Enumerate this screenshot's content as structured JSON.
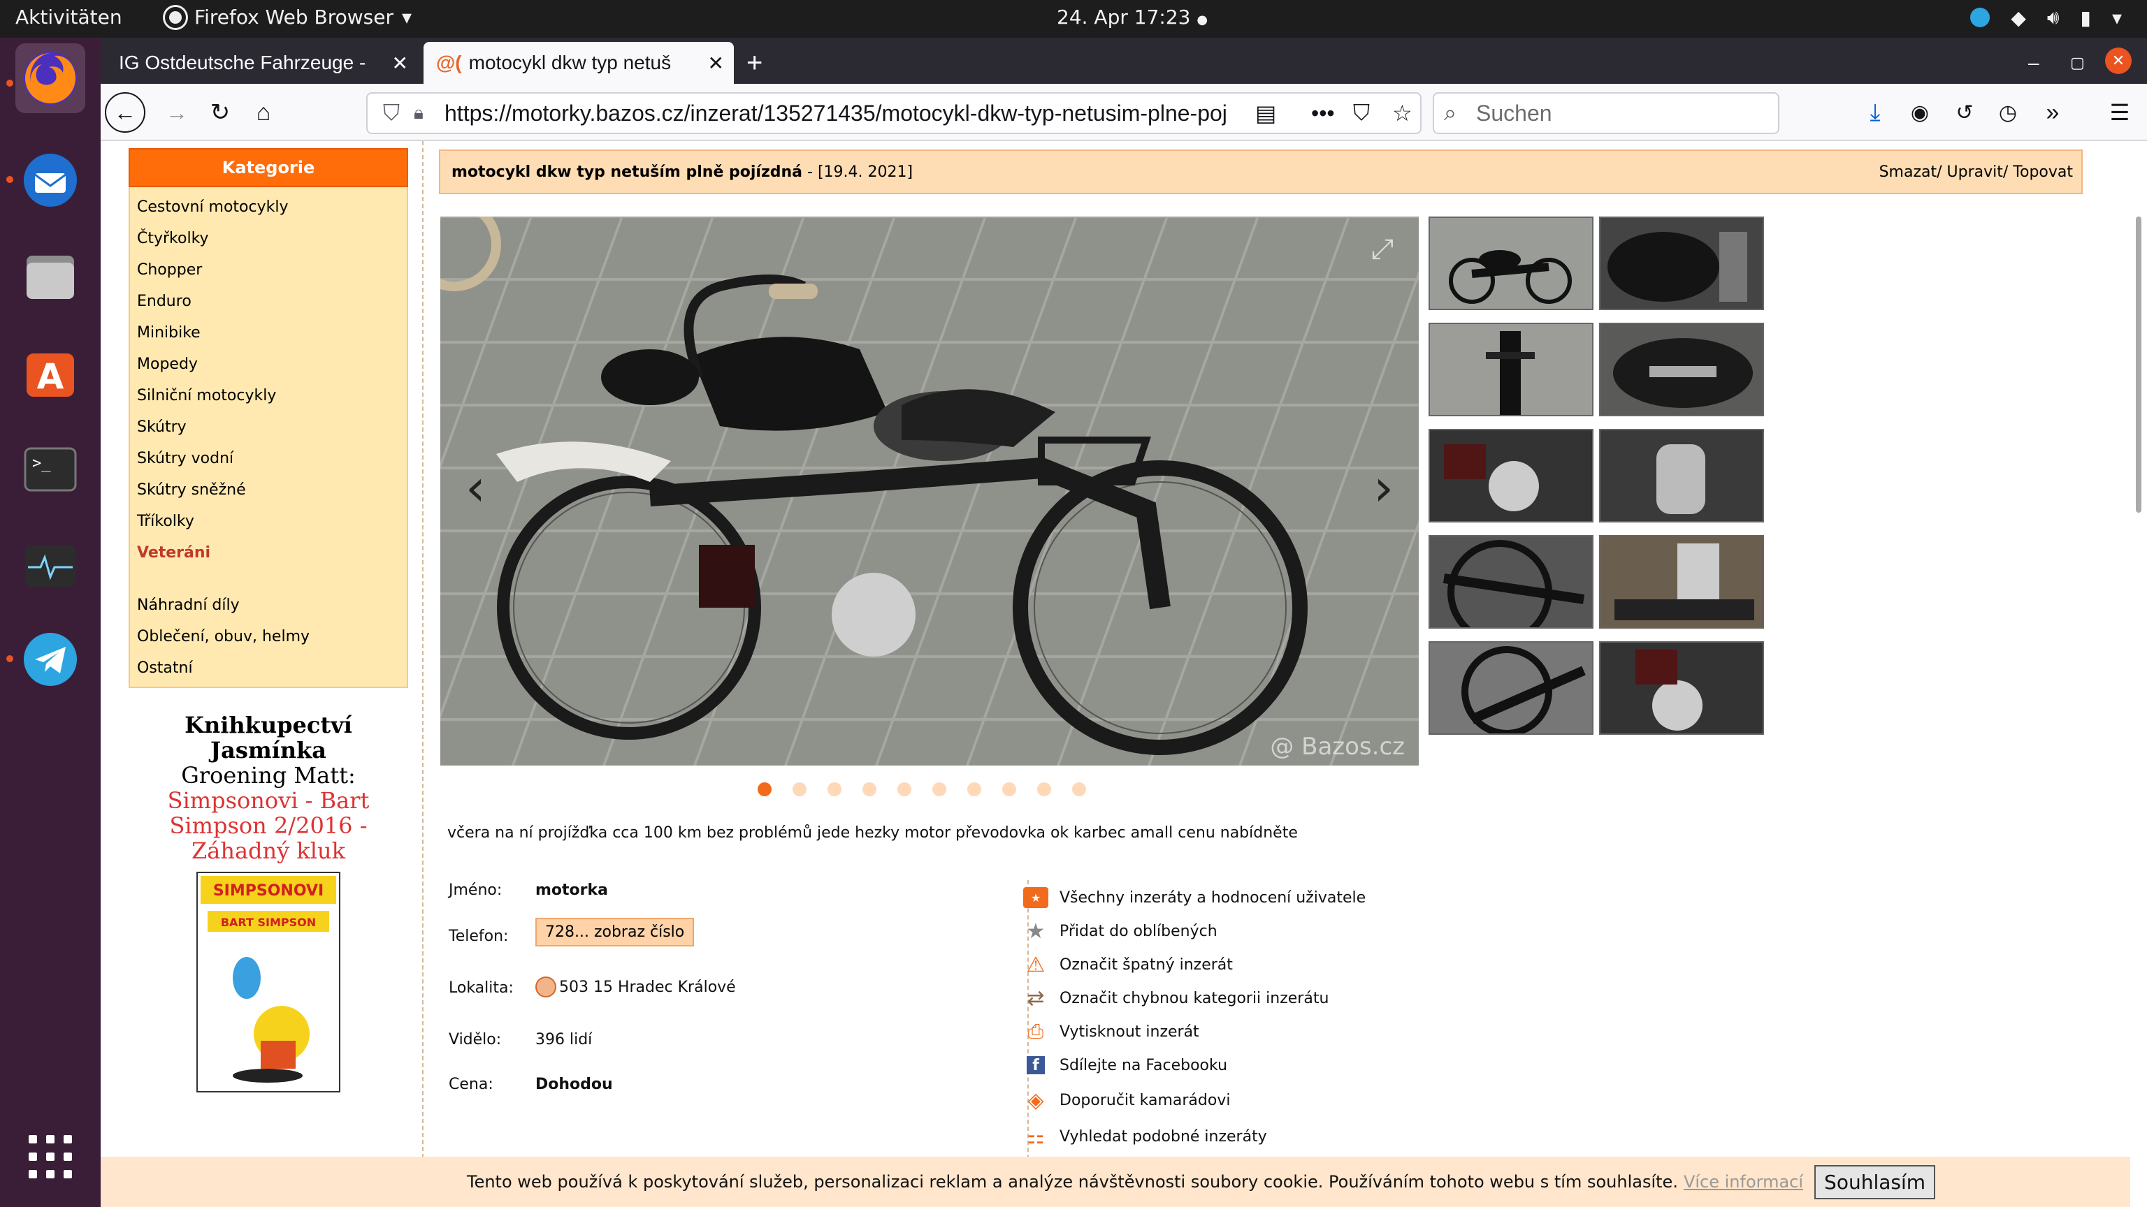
{
  "system": {
    "activities": "Aktivitäten",
    "app_name": "Firefox Web Browser",
    "clock": "24. Apr  17:23"
  },
  "tabs": [
    {
      "label": "IG Ostdeutsche Fahrzeuge -"
    },
    {
      "label": "motocykl dkw typ netuš"
    }
  ],
  "nav": {
    "url": "https://motorky.bazos.cz/inzerat/135271435/motocykl-dkw-typ-netusim-plne-poj",
    "search_placeholder": "Suchen"
  },
  "sidebar": {
    "header": "Kategorie",
    "items": [
      "Cestovní motocykly",
      "Čtyřkolky",
      "Chopper",
      "Enduro",
      "Minibike",
      "Mopedy",
      "Silniční motocykly",
      "Skútry",
      "Skútry vodní",
      "Skútry sněžné",
      "Tříkolky",
      "Veteráni"
    ],
    "items2": [
      "Náhradní díly",
      "Oblečení, obuv, helmy",
      "Ostatní"
    ]
  },
  "book": {
    "line1": "Knihkupectví",
    "line2": "Jasmínka",
    "line3": "Groening Matt:",
    "line4": "Simpsonovi - Bart",
    "line5": "Simpson 2/2016 -",
    "line6": "Záhadný kluk",
    "cover_title": "SIMPSONOVI",
    "cover_sub": "BART SIMPSON"
  },
  "listing": {
    "title": "motocykl dkw typ netuším plně pojízdná",
    "date": "- [19.4. 2021]",
    "actions": "Smazat/ Upravit/ Topovat",
    "watermark": "@ Bazos.cz",
    "description": "včera na ní projížďka cca 100 km bez problémů jede hezky motor převodovka ok karbec amall cenu nabídněte"
  },
  "info": {
    "name_label": "Jméno:",
    "name": "motorka",
    "phone_label": "Telefon:",
    "phone": "728... zobraz číslo",
    "loc_label": "Lokalita:",
    "loc": "503 15 Hradec Králové",
    "views_label": "Vidělo:",
    "views": "396 lidí",
    "price_label": "Cena:",
    "price": "Dohodou"
  },
  "actions": [
    "Všechny inzeráty a hodnocení uživatele",
    "Přidat do oblíbených",
    "Označit špatný inzerát",
    "Označit chybnou kategorii inzerátu",
    "Vytisknout inzerát",
    "Sdílejte na Facebooku",
    "Doporučit kamarádovi",
    "Vyhledat podobné inzeráty"
  ],
  "cookie": {
    "text": "Tento web používá k poskytování služeb, personalizaci reklam a analýze návštěvnosti soubory cookie. Používáním tohoto webu s tím souhlasíte.",
    "more": "Více informací",
    "accept": "Souhlasím"
  },
  "carousel": {
    "current": 1,
    "total": 10
  },
  "colors": {
    "accent": "#ff6c0a",
    "sidebar_bg": "#ffe9b0",
    "title_bg": "#ffddb4",
    "dock": "#3a1e38"
  }
}
